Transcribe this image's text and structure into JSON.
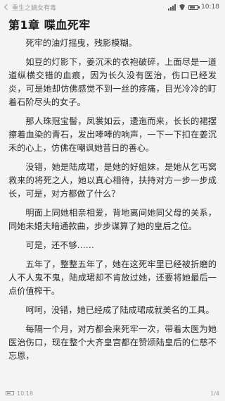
{
  "status_bar": {
    "back_text": "重生之嫡女有毒",
    "time": "10:18",
    "battery_level": 0.7
  },
  "reader": {
    "chapter_title": "第1章 喋血死牢",
    "paragraphs": [
      "死牢的油灯摇曳，残影模糊。",
      "如豆的灯影下，姜沉禾的衣袍破碎，上面尽是一道道纵横交错的血痕，因为长久没有医治，伤口已经发炎，可是她却仿佛感觉不到一丝的疼痛，目光冷冷的盯着石阶尽头的女子。",
      "那人珠冠宝髻，凤裳如云，逶迤而来，长长的裙摆擦着血染的青石，发出唪唪的响声，一下一下扣在姜沉禾的心上，仿佛在嘲讽她昔日的善心。",
      "没错，她是陆成珺，是她的好姐妹，是她从乞丐窝救来的将死之人，她以真心相待，扶持对方一步一步成长，可是，对方都做了什么？",
      "明面上同她相亲相爱，背地离间她同父母的关系，同她未婚夫暗通款曲，步步谋算了她的皇后之位。",
      "可是，还不够……",
      "五年了，整整五年了，她在这死牢里已经被折磨的人不人鬼不鬼，陆成珺却不肯放过她，还要将她最后一点价值榨干。",
      "呵呵，没错，她已经成了陆成珺成就美名的工具。",
      "每隔一个月，对方都会来死牢一次，带着太医为她医治伤口，现在整个大齐皇宫都在赞颂陆皇后的仁慈不忘恩，"
    ]
  },
  "footer": {
    "time": "10:18",
    "page": "1/4",
    "battery_level": 0.6
  }
}
